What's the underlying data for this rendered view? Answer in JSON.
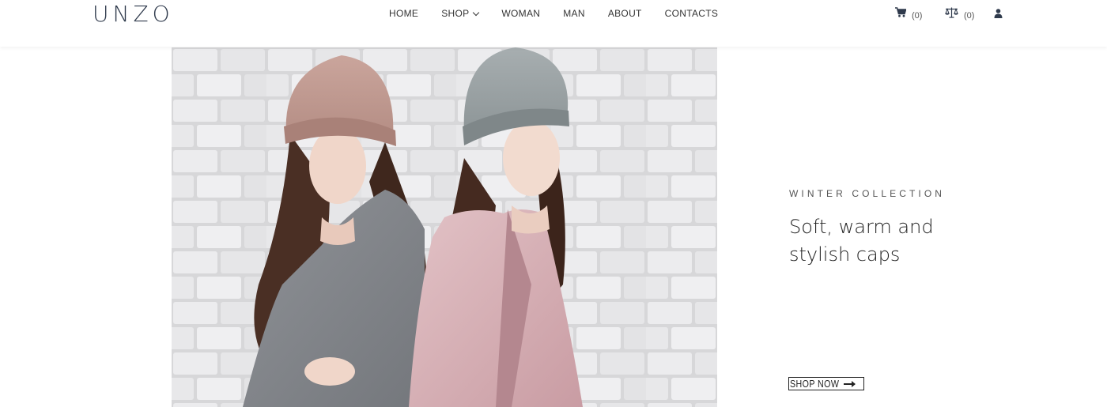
{
  "brand": {
    "logo": "UNZO"
  },
  "nav": {
    "items": [
      {
        "label": "HOME"
      },
      {
        "label": "SHOP"
      },
      {
        "label": "WOMAN"
      },
      {
        "label": "MAN"
      },
      {
        "label": "ABOUT"
      },
      {
        "label": "CONTACTS"
      }
    ]
  },
  "header_icons": {
    "cart": {
      "icon": "cart-icon",
      "count": "(0)"
    },
    "compare": {
      "icon": "scale-icon",
      "count": "(0)"
    },
    "user": {
      "icon": "user-icon"
    }
  },
  "hero": {
    "subtitle": "WINTER COLLECTION",
    "headline": "Soft, warm and stylish caps",
    "button_label": "SHOP NOW",
    "image": "two women in knitted beanies in front of a white brick wall"
  },
  "colors": {
    "logo": "#2f3a4c",
    "text": "#222222",
    "accent_pink": "#d9b3b8",
    "accent_grey": "#8e9599"
  }
}
